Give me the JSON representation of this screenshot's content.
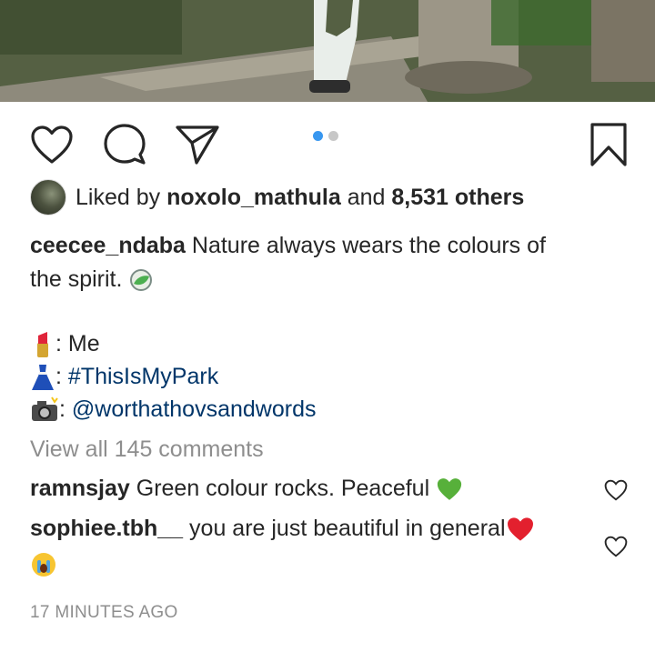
{
  "post": {
    "likes": {
      "prefix": "Liked by",
      "user": "noxolo_mathula",
      "and": "and",
      "others": "8,531 others"
    },
    "caption": {
      "username": "ceecee_ndaba",
      "text_line1": "Nature always wears the colours of",
      "text_line2": "the spirit.",
      "credits": [
        {
          "icon": "lipstick-emoji",
          "sep": ": ",
          "value": "Me"
        },
        {
          "icon": "dress-emoji",
          "sep": ": ",
          "value": "#ThisIsMyPark"
        },
        {
          "icon": "camera-flash-emoji",
          "sep": ": ",
          "value": "@worthathovsandwords"
        }
      ]
    },
    "view_comments": "View all 145 comments",
    "comments": [
      {
        "username": "ramnsjay",
        "text": "Green colour rocks. Peaceful",
        "emoji": "green-heart"
      },
      {
        "username": "sophiee.tbh__",
        "text": "you are just beautiful in general",
        "emoji": "red-heart",
        "emoji2": "crying-face"
      }
    ],
    "timestamp": "17 MINUTES AGO",
    "carousel": {
      "total": 2,
      "active": 1
    }
  },
  "colors": {
    "accent_blue": "#3897f0",
    "link": "#003569",
    "muted": "#8e8e8e",
    "text": "#262626"
  }
}
